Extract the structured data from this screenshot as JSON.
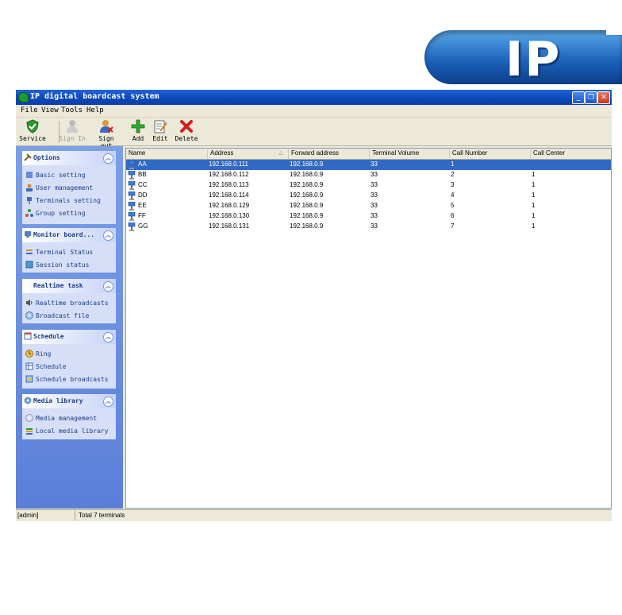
{
  "badge": {
    "text": "IP"
  },
  "window": {
    "title": "IP digital boardcast system"
  },
  "menu": [
    "File",
    "View",
    "Tools",
    "Help"
  ],
  "toolbar": {
    "service": "Service",
    "sign_in": "Sign In",
    "sign_out": "Sign out",
    "add": "Add",
    "edit": "Edit",
    "delete": "Delete"
  },
  "sidebar": {
    "options": {
      "title": "Options",
      "items": [
        "Basic setting",
        "User management",
        "Terminals setting",
        "Group setting"
      ]
    },
    "monitor": {
      "title": "Monitor board...",
      "items": [
        "Terminal Status",
        "Session status"
      ]
    },
    "realtime": {
      "title": "Realtime task",
      "items": [
        "Realtime broadcasts",
        "Broadcast file"
      ]
    },
    "schedule": {
      "title": "Schedule",
      "items": [
        "Ring",
        "Schedule",
        "Schedule broadcasts"
      ]
    },
    "media": {
      "title": "Media library",
      "items": [
        "Media management",
        "Local media library"
      ]
    }
  },
  "table": {
    "columns": [
      "Name",
      "Address",
      "Forward address",
      "Terminal Volume",
      "Call Number",
      "Call Center"
    ],
    "rows": [
      {
        "name": "AA",
        "address": "192.168.0.111",
        "forward": "192.168.0.9",
        "volume": "33",
        "call_number": "1",
        "call_center": ""
      },
      {
        "name": "BB",
        "address": "192.168.0.112",
        "forward": "192.168.0.9",
        "volume": "33",
        "call_number": "2",
        "call_center": "1"
      },
      {
        "name": "CC",
        "address": "192.168.0.113",
        "forward": "192.168.0.9",
        "volume": "33",
        "call_number": "3",
        "call_center": "1"
      },
      {
        "name": "DD",
        "address": "192.168.0.114",
        "forward": "192.168.0.9",
        "volume": "33",
        "call_number": "4",
        "call_center": "1"
      },
      {
        "name": "EE",
        "address": "192.168.0.129",
        "forward": "192.168.0.9",
        "volume": "33",
        "call_number": "5",
        "call_center": "1"
      },
      {
        "name": "FF",
        "address": "192.168.0.130",
        "forward": "192.168.0.9",
        "volume": "33",
        "call_number": "6",
        "call_center": "1"
      },
      {
        "name": "GG",
        "address": "192.168.0.131",
        "forward": "192.168.0.9",
        "volume": "33",
        "call_number": "7",
        "call_center": "1"
      }
    ]
  },
  "status": {
    "user": "[admin]",
    "total": "Total 7 terminals"
  }
}
